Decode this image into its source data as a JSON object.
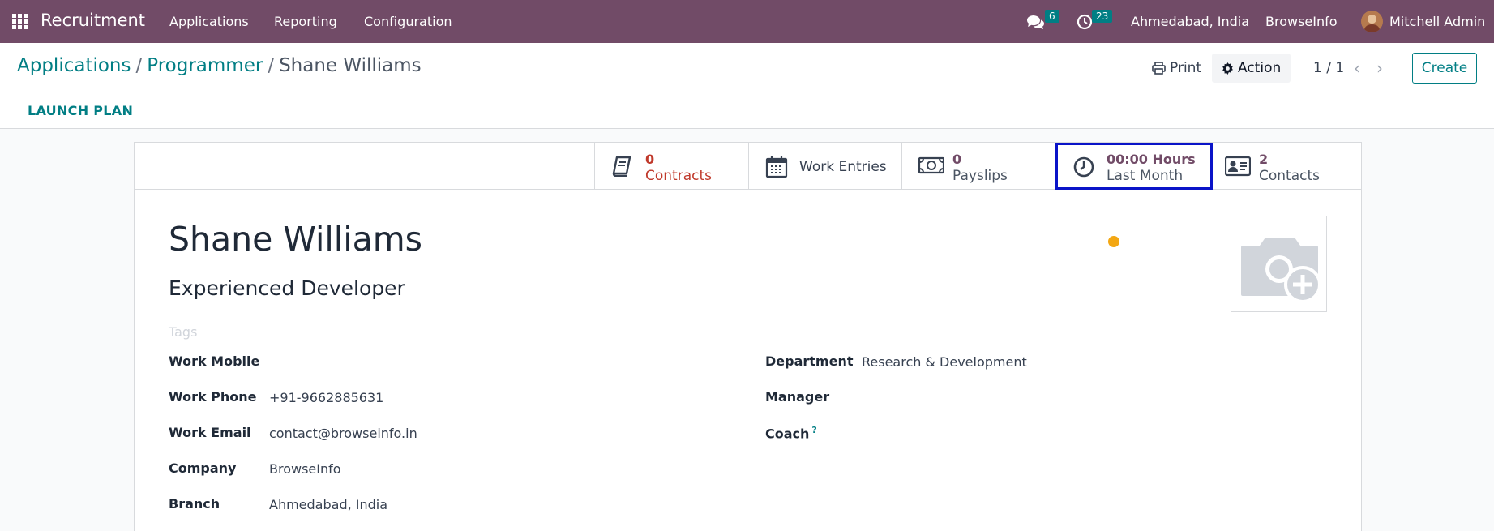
{
  "navbar": {
    "app_name": "Recruitment",
    "menus": [
      "Applications",
      "Reporting",
      "Configuration"
    ],
    "messages_count": "6",
    "activities_count": "23",
    "location": "Ahmedabad, India",
    "company": "BrowseInfo",
    "user": "Mitchell Admin"
  },
  "control": {
    "breadcrumb": [
      "Applications",
      "Programmer",
      "Shane Williams"
    ],
    "print_label": "Print",
    "action_label": "Action",
    "pager": "1 / 1",
    "create_label": "Create"
  },
  "statusbar": {
    "launch_plan": "LAUNCH PLAN"
  },
  "smart_buttons": {
    "contracts": {
      "value": "0",
      "label": "Contracts"
    },
    "work_entries": {
      "label": "Work Entries"
    },
    "payslips": {
      "value": "0",
      "label": "Payslips"
    },
    "hours": {
      "value": "00:00 Hours",
      "label": "Last Month"
    },
    "contacts": {
      "value": "2",
      "label": "Contacts"
    }
  },
  "employee": {
    "name": "Shane Williams",
    "job_title": "Experienced Developer",
    "tags_placeholder": "Tags"
  },
  "fields_left": [
    {
      "label": "Work Mobile",
      "value": ""
    },
    {
      "label": "Work Phone",
      "value": "+91-9662885631"
    },
    {
      "label": "Work Email",
      "value": "contact@browseinfo.in"
    },
    {
      "label": "Company",
      "value": "BrowseInfo"
    },
    {
      "label": "Branch",
      "value": "Ahmedabad, India"
    }
  ],
  "fields_right": [
    {
      "label": "Department",
      "value": "Research & Development"
    },
    {
      "label": "Manager",
      "value": ""
    },
    {
      "label": "Coach",
      "value": "",
      "help": "?"
    }
  ],
  "colors": {
    "navbar": "#714b67",
    "accent": "#017e84",
    "danger": "#c0392b",
    "highlight_border": "#0a14c8",
    "status_dot": "#f3a713"
  }
}
